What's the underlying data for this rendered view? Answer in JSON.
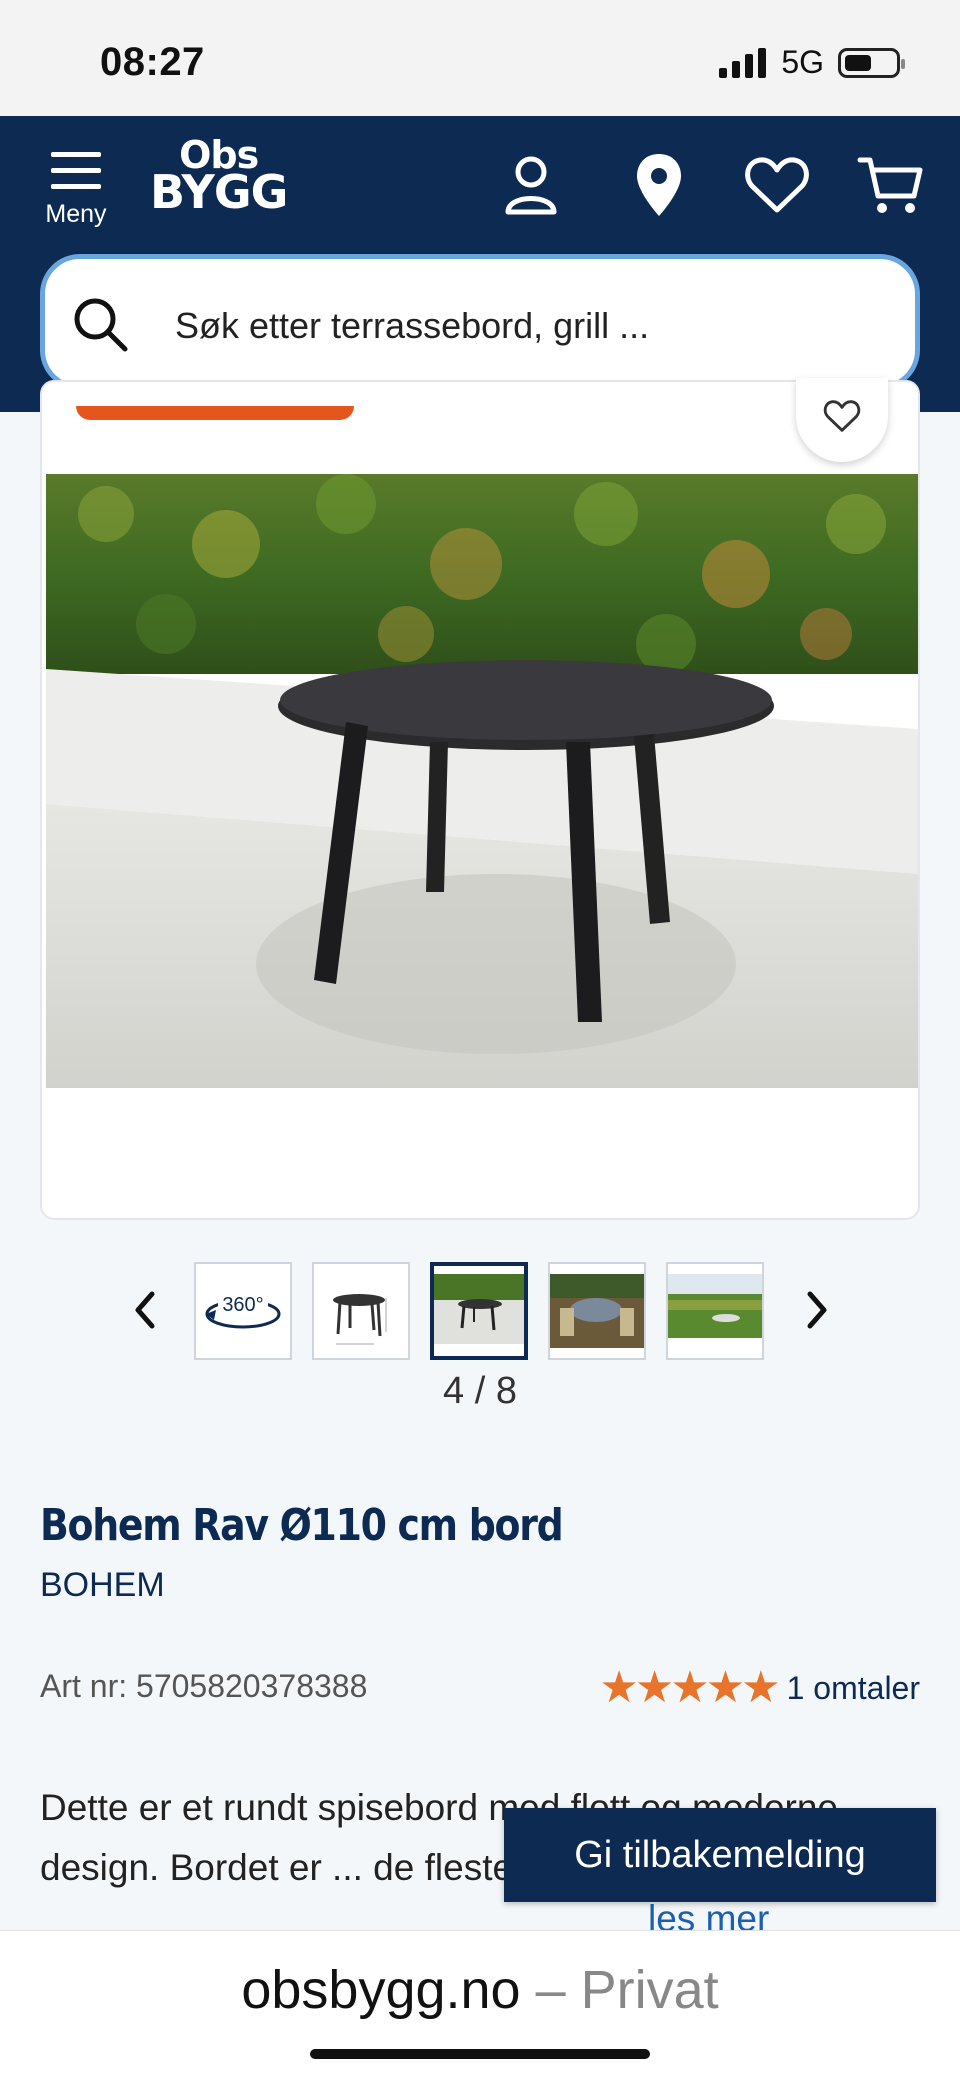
{
  "status_bar": {
    "time": "08:27",
    "network": "5G"
  },
  "header": {
    "menu_label": "Meny",
    "logo_line1": "Obs",
    "logo_line2": "BYGG",
    "icons": [
      "user-icon",
      "location-pin-icon",
      "heart-icon",
      "cart-icon"
    ],
    "search_placeholder": "Søk etter terrassebord, grill ..."
  },
  "gallery": {
    "counter": "4 / 8",
    "thumbnail_360_label": "360°",
    "current_index": 4,
    "total": 8
  },
  "product": {
    "title": "Bohem Rav Ø110 cm bord",
    "brand": "BOHEM",
    "art_nr": "Art nr: 5705820378388",
    "rating_stars": 5,
    "stars_glyphs": "★★★★★",
    "review_count_label": "1 omtaler",
    "description": "Dette er et rundt spisebord med flott og moderne design. Bordet er ... de fleste stoler passer. Det har",
    "read_more": "les mer"
  },
  "feedback_button": "Gi tilbakemelding",
  "browser": {
    "domain": "obsbygg.no",
    "suffix": " – Privat"
  },
  "colors": {
    "brand_navy": "#0d2a52",
    "accent_orange": "#e5561f",
    "star_orange": "#e8732a",
    "link_blue": "#1a5fb4",
    "search_border": "#6aa6de"
  }
}
